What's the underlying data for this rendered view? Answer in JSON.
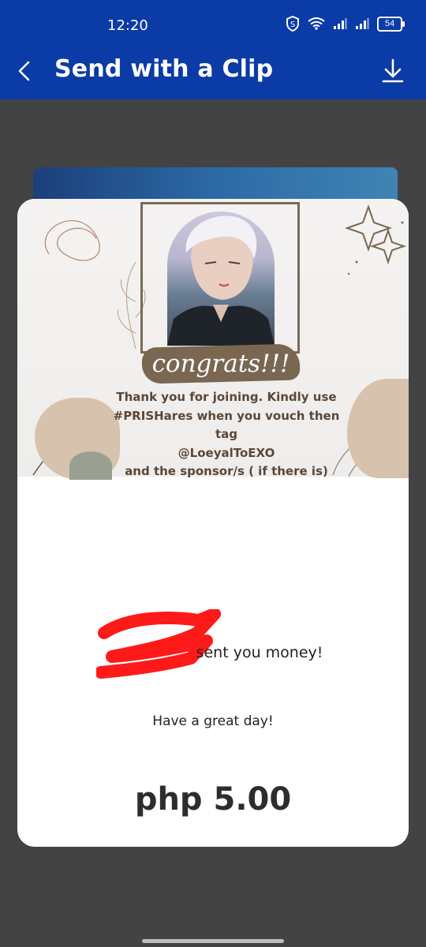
{
  "status_bar": {
    "time": "12:20",
    "battery": "54",
    "icons": [
      "shield-s-icon",
      "wifi-icon",
      "signal-icon",
      "signal-icon",
      "battery-icon"
    ]
  },
  "app_bar": {
    "title": "Send with a Clip",
    "back_icon": "back-arrow-icon",
    "download_icon": "download-icon",
    "color": "#0b3ba6"
  },
  "clip": {
    "congrats": "congrats!!!",
    "lines": [
      "Thank you for joining. Kindly use",
      "#PRISHares when you vouch then tag",
      "@LoeyalToEXO",
      "and the sponsor/s ( if there is)"
    ]
  },
  "message": {
    "sent_text": "sent you money!",
    "greeting": "Have a great day!",
    "amount": "php 5.00"
  }
}
